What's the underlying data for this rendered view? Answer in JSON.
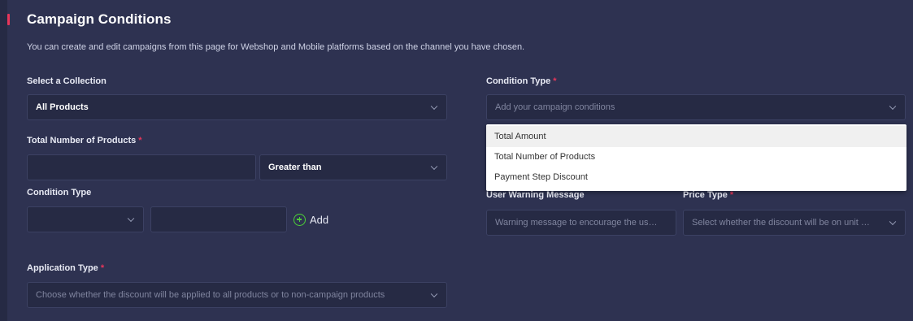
{
  "page": {
    "title": "Campaign Conditions",
    "description": "You can create and edit campaigns from this page for Webshop and Mobile platforms based on the channel you have chosen."
  },
  "collection": {
    "label": "Select a Collection",
    "value": "All Products"
  },
  "total_products": {
    "label": "Total Number of Products",
    "required": "*",
    "input_value": "",
    "operator_value": "Greater than"
  },
  "condition_type_left": {
    "label": "Condition Type",
    "select_value": "",
    "input_value": "",
    "add_label": "Add"
  },
  "application_type": {
    "label": "Application Type",
    "required": "*",
    "placeholder": "Choose whether the discount will be applied to all products or to non-campaign products"
  },
  "condition_type_right": {
    "label": "Condition Type",
    "required": "*",
    "placeholder": "Add your campaign conditions",
    "options": [
      "Total Amount",
      "Total Number of Products",
      "Payment Step Discount"
    ]
  },
  "warning": {
    "label": "User Warning Message",
    "placeholder": "Warning message to encourage the us…"
  },
  "price_type": {
    "label": "Price Type",
    "required": "*",
    "placeholder": "Select whether the discount will be on unit …"
  },
  "colors": {
    "background": "#2e3251",
    "field_bg": "#262a44",
    "accent": "#e8365a",
    "add_green": "#4cd137"
  }
}
